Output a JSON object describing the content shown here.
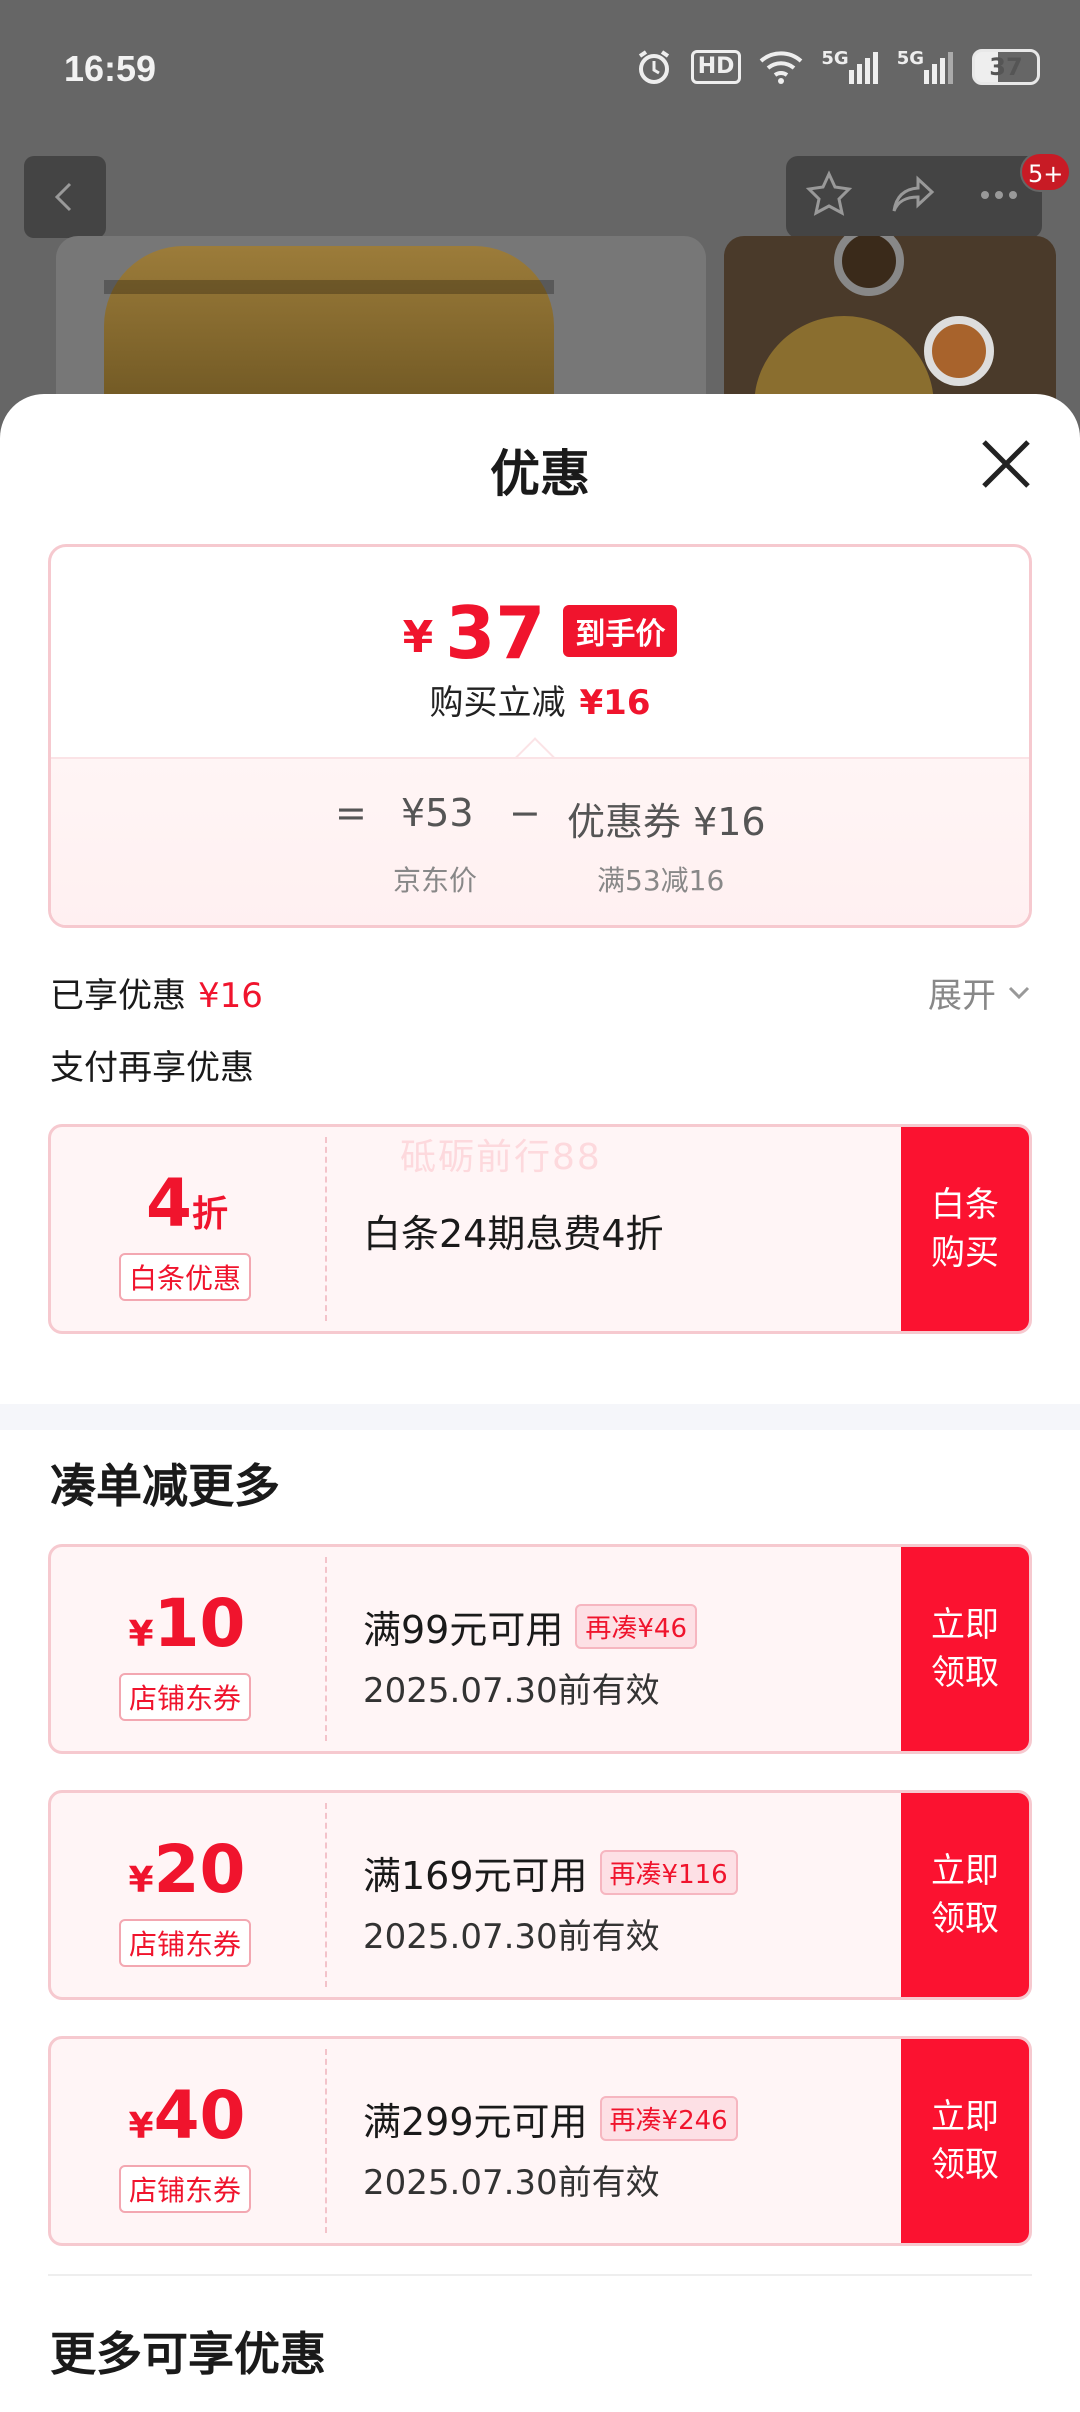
{
  "status_bar": {
    "time": "16:59",
    "hd": "HD",
    "net1": "5G",
    "net2": "5G",
    "battery": "37"
  },
  "product_bg": {
    "badge": "5+"
  },
  "sheet": {
    "title": "优惠",
    "price_card": {
      "currency": "¥",
      "final_price": "37",
      "final_tag": "到手价",
      "save_label": "购买立减",
      "save_amount": "¥16",
      "equals": "=",
      "base_price": "¥53",
      "minus": "−",
      "coupon_text": "优惠券 ¥16",
      "base_label": "京东价",
      "coupon_rule": "满53减16"
    },
    "enjoyed": {
      "label": "已享优惠",
      "amount": "¥16",
      "expand": "展开"
    },
    "pay_more_title": "支付再享优惠",
    "baitiao": {
      "amount": "4",
      "unit": "折",
      "sub": "白条优惠",
      "desc": "白条24期息费4折",
      "button": "白条\n购买",
      "button_l1": "白条",
      "button_l2": "购买",
      "watermark": "砥砺前行88"
    },
    "bundle_title": "凑单减更多",
    "coupons": [
      {
        "currency": "¥",
        "amount": "10",
        "sub": "店铺东券",
        "desc": "满99元可用",
        "chip": "再凑¥46",
        "valid": "2025.07.30前有效",
        "btn_l1": "立即",
        "btn_l2": "领取"
      },
      {
        "currency": "¥",
        "amount": "20",
        "sub": "店铺东券",
        "desc": "满169元可用",
        "chip": "再凑¥116",
        "valid": "2025.07.30前有效",
        "btn_l1": "立即",
        "btn_l2": "领取"
      },
      {
        "currency": "¥",
        "amount": "40",
        "sub": "店铺东券",
        "desc": "满299元可用",
        "chip": "再凑¥246",
        "valid": "2025.07.30前有效",
        "btn_l1": "立即",
        "btn_l2": "领取"
      }
    ],
    "more_title": "更多可享优惠"
  },
  "colors": {
    "accent": "#f0142d",
    "button_red": "#fb1230",
    "card_border": "#f6c9cf",
    "card_bg": "#fff5f6"
  }
}
